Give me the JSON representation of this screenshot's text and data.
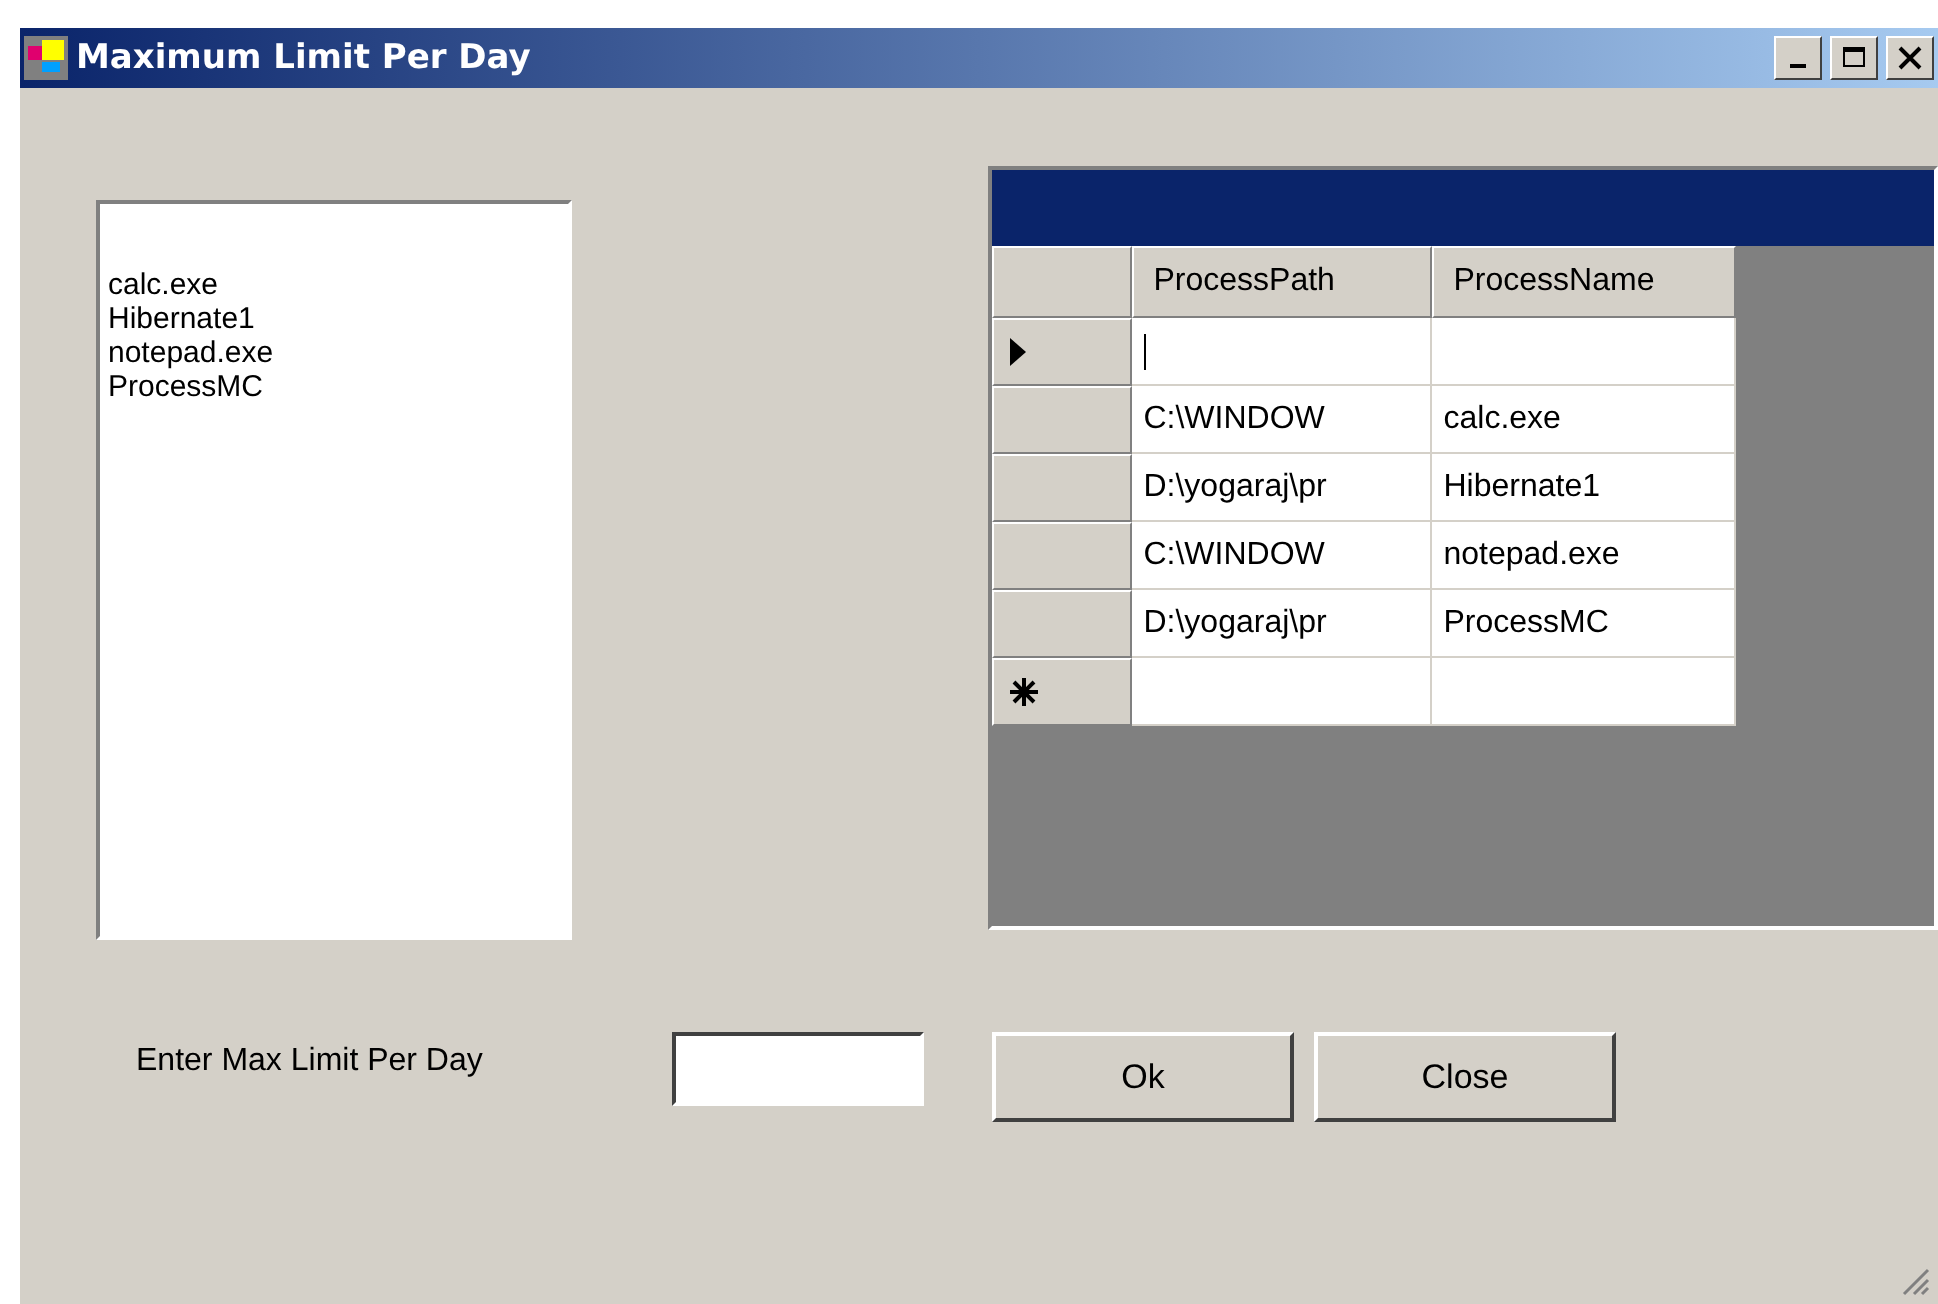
{
  "window": {
    "title": "Maximum Limit Per Day"
  },
  "process_list": {
    "items": [
      "calc.exe",
      "Hibernate1",
      "notepad.exe",
      "ProcessMC"
    ]
  },
  "grid": {
    "columns": [
      "ProcessPath",
      "ProcessName"
    ],
    "rows": [
      {
        "kind": "current",
        "cells": [
          "",
          ""
        ]
      },
      {
        "kind": "data",
        "cells": [
          "C:\\WINDOW",
          "calc.exe"
        ]
      },
      {
        "kind": "data",
        "cells": [
          "D:\\yogaraj\\pr",
          "Hibernate1"
        ]
      },
      {
        "kind": "data",
        "cells": [
          "C:\\WINDOW",
          "notepad.exe"
        ]
      },
      {
        "kind": "data",
        "cells": [
          "D:\\yogaraj\\pr",
          "ProcessMC"
        ]
      },
      {
        "kind": "new",
        "cells": [
          "",
          ""
        ]
      }
    ]
  },
  "limit_label": "Enter Max Limit Per Day",
  "buttons": [
    "Ok",
    "Close"
  ]
}
